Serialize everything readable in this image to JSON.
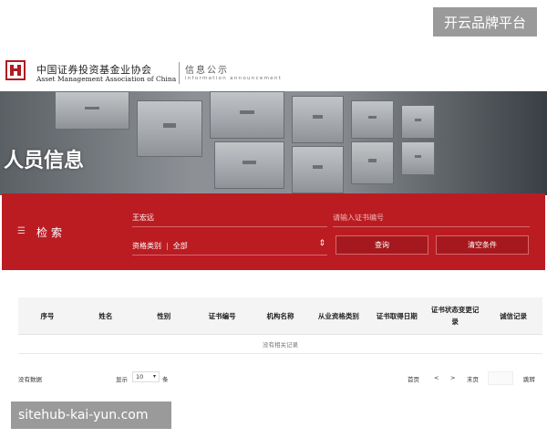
{
  "watermarks": {
    "top_right": "开云品牌平台",
    "bottom_left": "sitehub-kai-yun.com"
  },
  "header": {
    "org_name_cn": "中国证券投资基金业协会",
    "org_name_en": "Asset Management Association of China",
    "section_cn": "信息公示",
    "section_en": "information announcement",
    "logo_icon": "amac-logo-icon"
  },
  "banner": {
    "title": "人员信息"
  },
  "search": {
    "label": "检索",
    "icon": "search-filter-icon",
    "name_value": "王宏远",
    "cert_placeholder": "请输入证书编号",
    "qual_label": "资格类别",
    "qual_value": "全部",
    "search_button": "查询",
    "clear_button": "清空条件"
  },
  "table": {
    "columns": [
      "序号",
      "姓名",
      "性别",
      "证书编号",
      "机构名称",
      "从业资格类别",
      "证书取得日期",
      "证书状态变更记录",
      "诚信记录"
    ],
    "empty_text": "没有相关记录"
  },
  "footer": {
    "no_data": "没有数据",
    "show_label": "显示",
    "page_size": "10",
    "items_label": "条",
    "first": "首页",
    "prev": "<",
    "next": ">",
    "last": "末页",
    "jump": "跳转"
  },
  "colors": {
    "brand_red": "#bb1c22",
    "button_red": "#a5181d"
  }
}
